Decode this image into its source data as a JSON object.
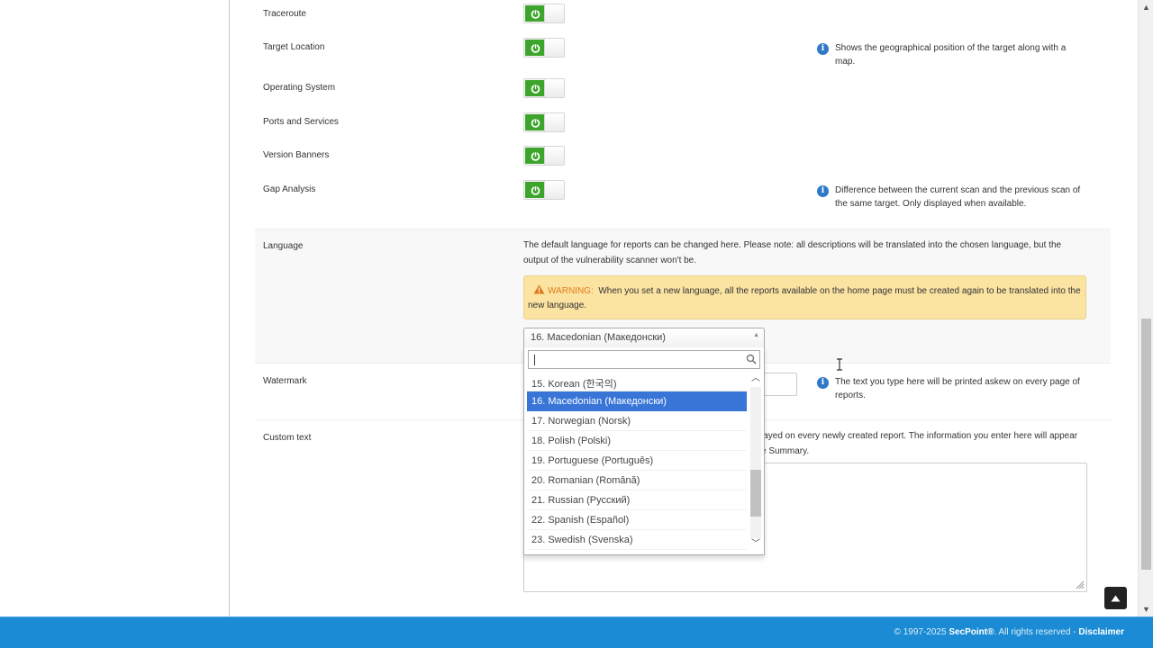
{
  "options": [
    {
      "label": "Traceroute",
      "enabled": true
    },
    {
      "label": "Target Location",
      "enabled": true
    },
    {
      "label": "Operating System",
      "enabled": true
    },
    {
      "label": "Ports and Services",
      "enabled": true
    },
    {
      "label": "Version Banners",
      "enabled": true
    },
    {
      "label": "Gap Analysis",
      "enabled": true
    }
  ],
  "info": {
    "target_location": "Shows the geographical position of the target along with a map.",
    "gap_analysis": "Difference between the current scan and the previous scan of the same target. Only displayed when available.",
    "watermark": "The text you type here will be printed askew on every page of reports."
  },
  "language": {
    "label": "Language",
    "description": "The default language for reports can be changed here. Please note: all descriptions will be translated into the chosen language, but the output of the vulnerability scanner won't be.",
    "warning_label": "WARNING:",
    "warning_text": "When you set a new language, all the reports available on the home page must be created again to be translated into the new language.",
    "selected": "16. Macedonian (Македонски)",
    "search_value": "",
    "options": [
      "15. Korean (한국의)",
      "16. Macedonian (Македонски)",
      "17. Norwegian (Norsk)",
      "18. Polish (Polski)",
      "19. Portuguese (Português)",
      "20. Romanian (Română)",
      "21. Russian (Русский)",
      "22. Spanish (Español)",
      "23. Swedish (Svenska)"
    ],
    "selected_index": 1
  },
  "watermark": {
    "label": "Watermark",
    "value": ""
  },
  "custom_text": {
    "label": "Custom text",
    "description_visible": "layed on every newly created report. The information you enter here will appear",
    "description_visible_2": "e Summary.",
    "value": ""
  },
  "footer": {
    "copyright": "© 1997-2025",
    "brand": "SecPoint®",
    "rights": ". All rights reserved -",
    "disclaimer": "Disclaimer"
  },
  "colors": {
    "toggle_on": "#3ea52c",
    "selected_item": "#3875d7",
    "warning_bg": "#fbe3a2",
    "footer_bg": "#1a8bd4",
    "info_icon": "#2f79c9"
  },
  "icons": {
    "toggle": "power-icon",
    "info": "info-icon",
    "warning": "warning-triangle-icon",
    "search": "magnifier-icon",
    "back_to_top": "arrow-up-icon"
  }
}
